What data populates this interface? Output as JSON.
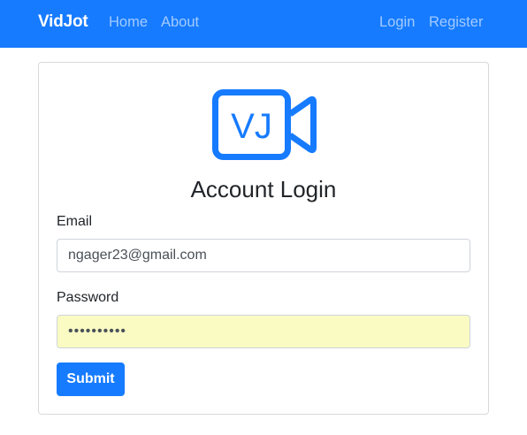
{
  "colors": {
    "primary": "#167bff",
    "autofill_background": "#fafbc3"
  },
  "navbar": {
    "brand": "VidJot",
    "links": [
      {
        "label": "Home"
      },
      {
        "label": "About"
      },
      {
        "label": "Login"
      },
      {
        "label": "Register"
      }
    ]
  },
  "logo": {
    "text": "VJ",
    "icon": "video-camera-icon"
  },
  "form": {
    "title": "Account Login",
    "email": {
      "label": "Email",
      "value": "ngager23@gmail.com"
    },
    "password": {
      "label": "Password",
      "value": "••••••••••"
    },
    "submit_label": "Submit"
  }
}
